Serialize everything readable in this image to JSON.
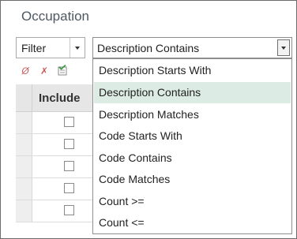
{
  "panel": {
    "title": "Occupation"
  },
  "filter_select": {
    "value": "Filter"
  },
  "description_select": {
    "value": "Description Contains"
  },
  "toolbar": {
    "icon1": "Ø",
    "icon2": "✗"
  },
  "grid": {
    "header": "Include",
    "rows": [
      {
        "checked": false
      },
      {
        "checked": false
      },
      {
        "checked": false
      },
      {
        "checked": false
      },
      {
        "checked": false
      }
    ]
  },
  "dropdown": {
    "selected_index": 1,
    "options": [
      "Description Starts With",
      "Description Contains",
      "Description Matches",
      "Code Starts With",
      "Code Contains",
      "Code Matches",
      "Count >=",
      "Count <="
    ]
  },
  "colors": {
    "selected_option_bg": "#dcebe4",
    "title_text": "#4d5862"
  }
}
